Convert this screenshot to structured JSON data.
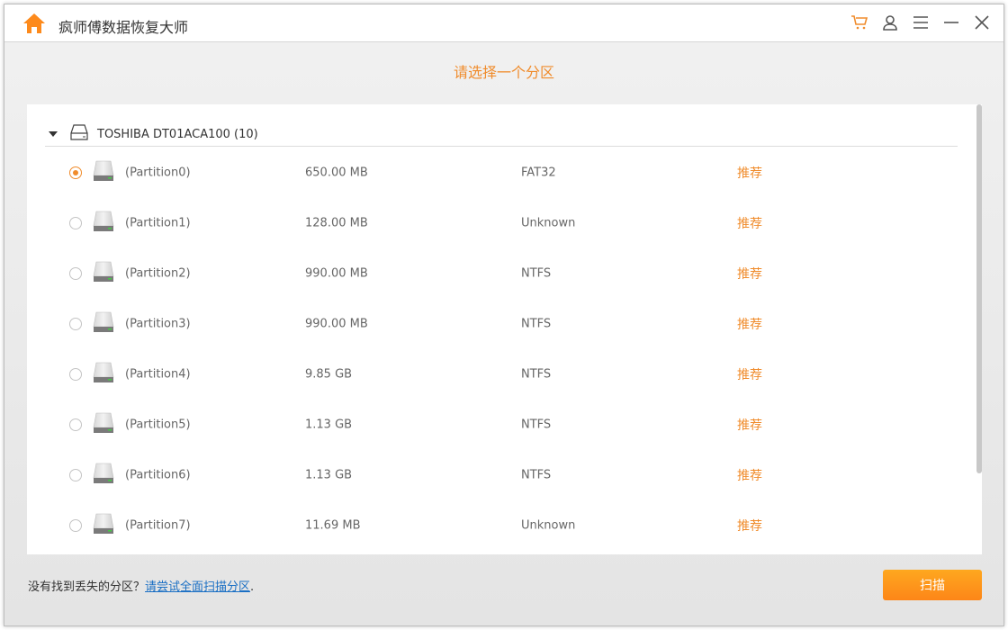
{
  "app": {
    "title": "疯师傅数据恢复大师"
  },
  "prompt": "请选择一个分区",
  "disk": {
    "name": "TOSHIBA DT01ACA100 (10)"
  },
  "partitions": [
    {
      "name": "(Partition0)",
      "size": "650.00 MB",
      "fs": "FAT32",
      "tag": "推荐",
      "selected": true
    },
    {
      "name": "(Partition1)",
      "size": "128.00 MB",
      "fs": "Unknown",
      "tag": "推荐",
      "selected": false
    },
    {
      "name": "(Partition2)",
      "size": "990.00 MB",
      "fs": "NTFS",
      "tag": "推荐",
      "selected": false
    },
    {
      "name": "(Partition3)",
      "size": "990.00 MB",
      "fs": "NTFS",
      "tag": "推荐",
      "selected": false
    },
    {
      "name": "(Partition4)",
      "size": "9.85 GB",
      "fs": "NTFS",
      "tag": "推荐",
      "selected": false
    },
    {
      "name": "(Partition5)",
      "size": "1.13 GB",
      "fs": "NTFS",
      "tag": "推荐",
      "selected": false
    },
    {
      "name": "(Partition6)",
      "size": "1.13 GB",
      "fs": "NTFS",
      "tag": "推荐",
      "selected": false
    },
    {
      "name": "(Partition7)",
      "size": "11.69 MB",
      "fs": "Unknown",
      "tag": "推荐",
      "selected": false
    }
  ],
  "footer": {
    "text": "没有找到丢失的分区？",
    "link": "请尝试全面扫描分区",
    "suffix": "."
  },
  "scan_label": "扫描",
  "colors": {
    "accent": "#f08c2c",
    "link": "#1a6fc4"
  }
}
